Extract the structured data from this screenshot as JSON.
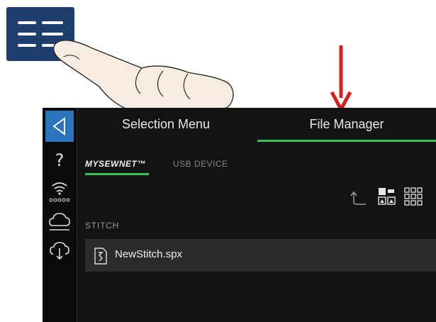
{
  "tabs": {
    "selection_menu": "Selection Menu",
    "file_manager": "File Manager"
  },
  "subtabs": {
    "mysewnet": "MYSEWNET™",
    "usb_device": "USB DEVICE"
  },
  "section": {
    "label": "STITCH"
  },
  "files": [
    {
      "name": "NewStitch.spx",
      "icon": "stitch-file-icon"
    }
  ],
  "rail_icons": [
    "back-icon",
    "help-icon",
    "wifi-icon",
    "cloud-icon",
    "cloud-download-icon"
  ],
  "toolbar_icons": [
    "folder-up-icon",
    "list-view-icon",
    "grid-view-icon"
  ],
  "colors": {
    "accent_green": "#3bbf56",
    "back_button_blue": "#2a73bd",
    "menu_button_navy": "#1e3f6e",
    "arrow_red": "#d62020"
  }
}
